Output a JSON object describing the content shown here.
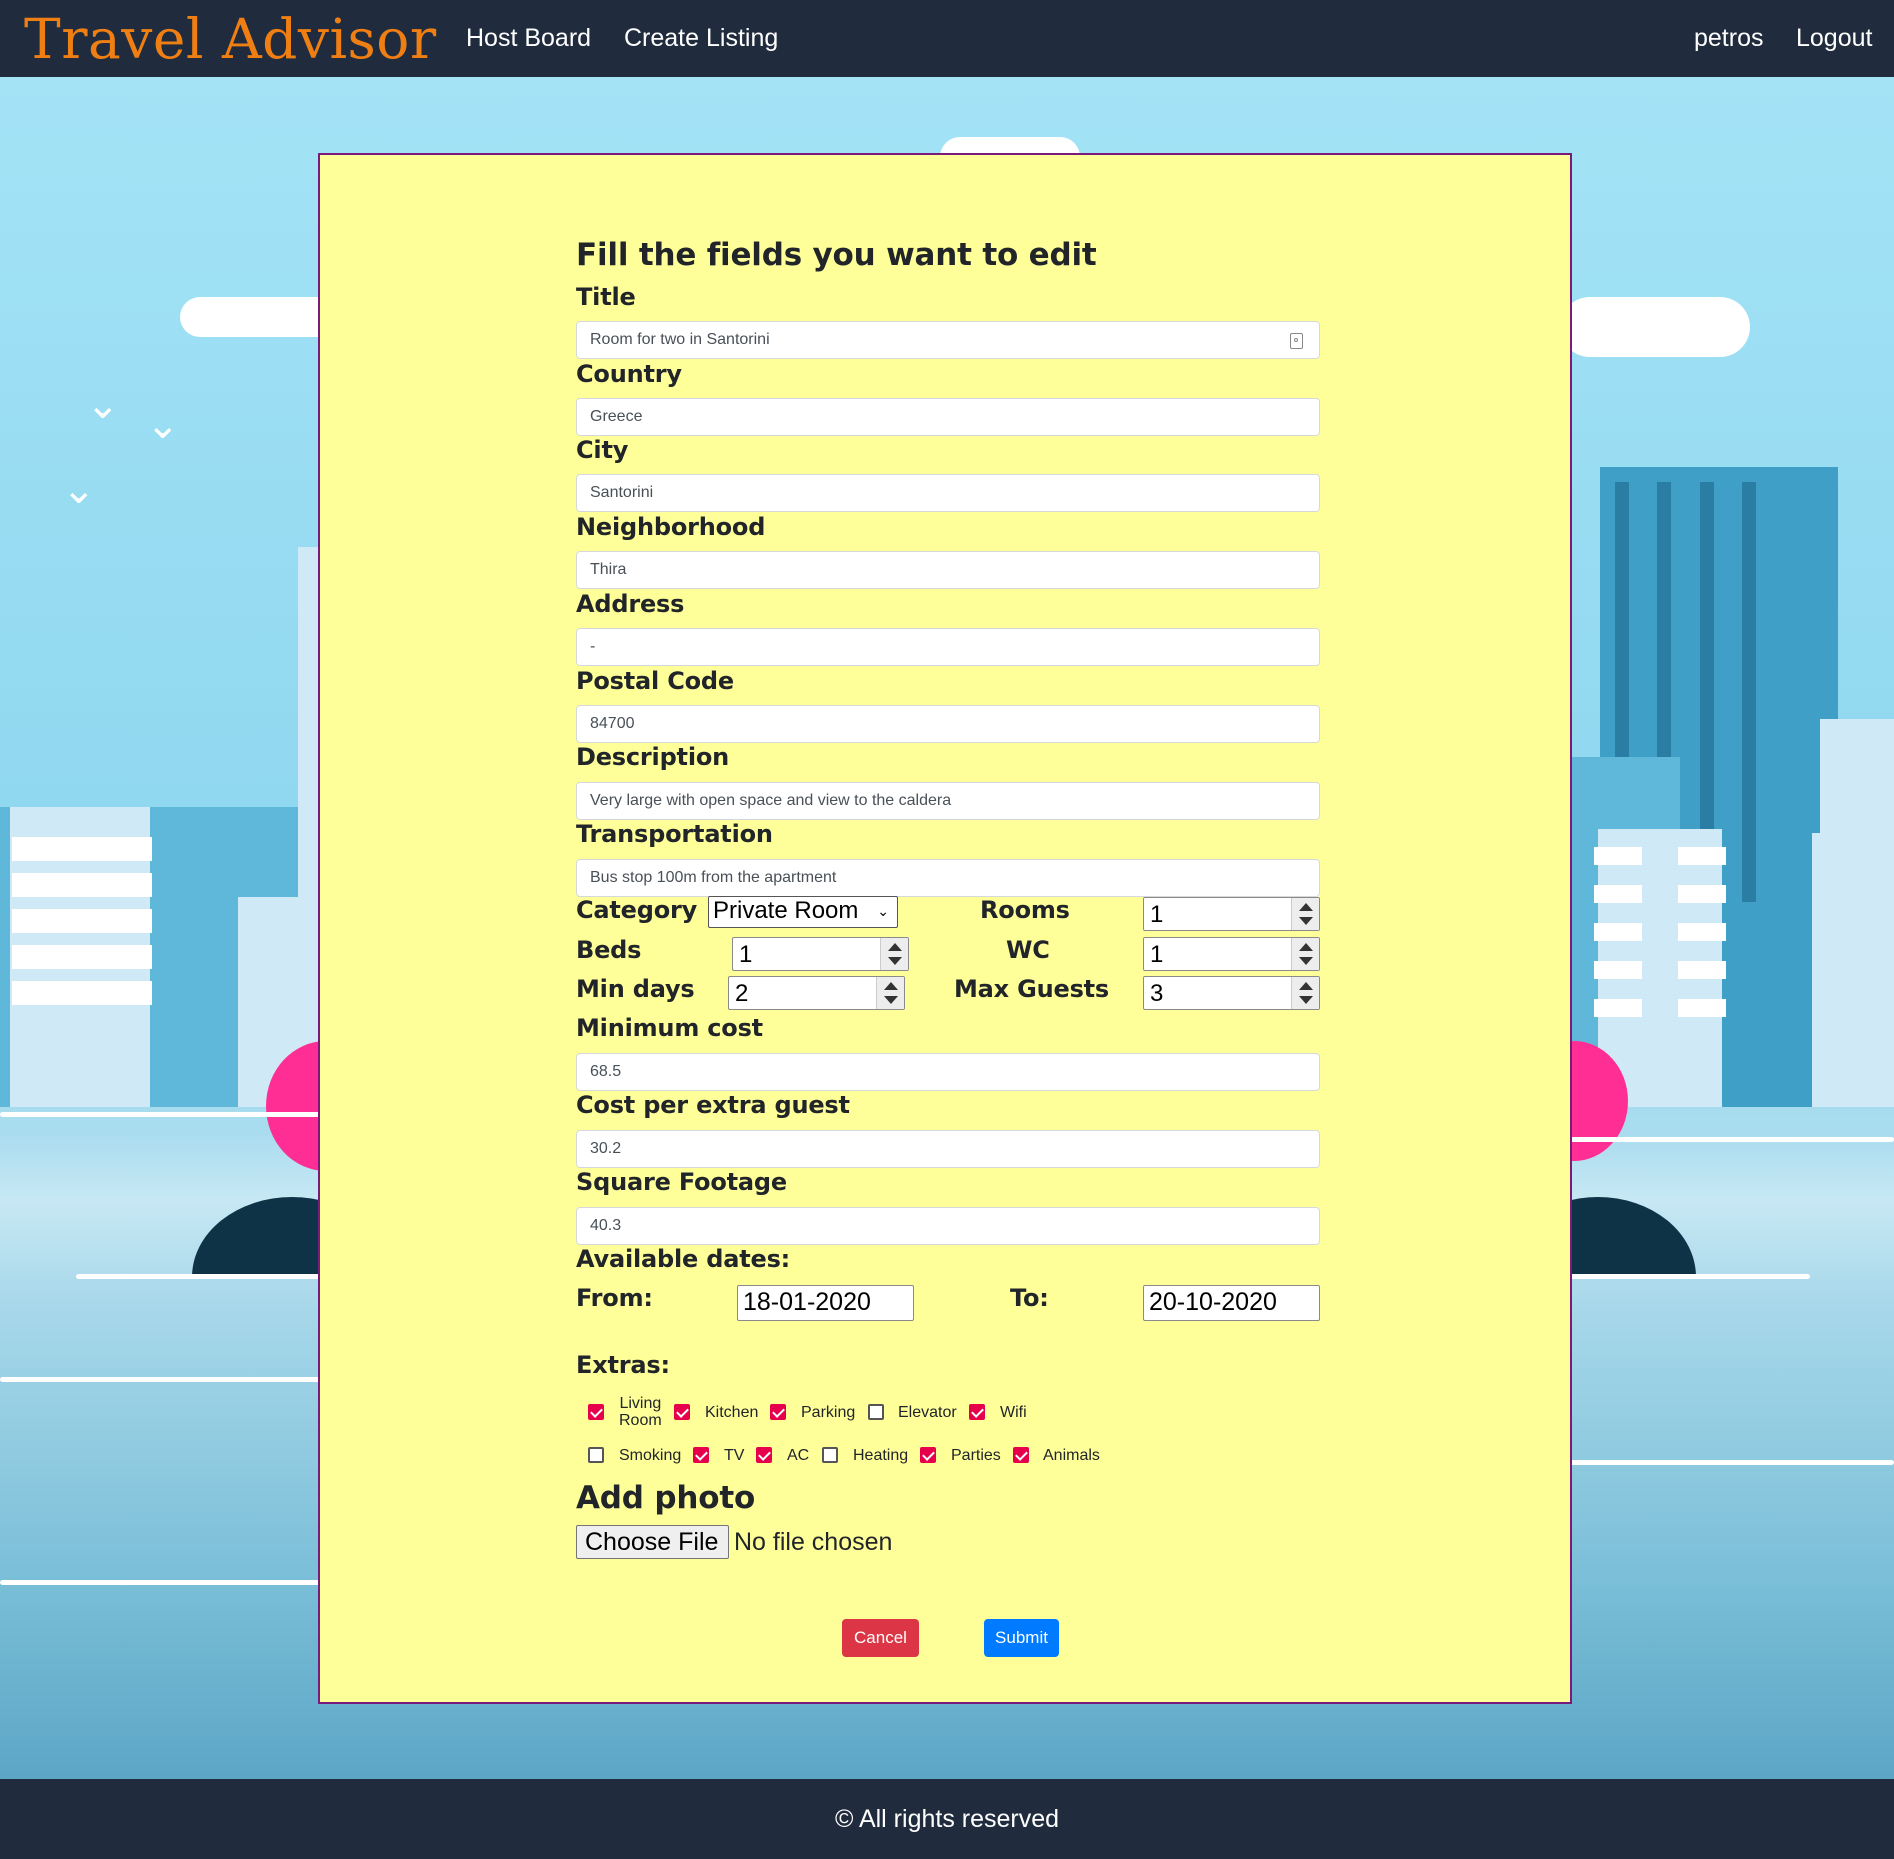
{
  "brand": {
    "name_first": "T",
    "name_rest": "ravel Advisor"
  },
  "nav": {
    "host_board": "Host Board",
    "create_listing": "Create Listing",
    "user": "petros",
    "logout": "Logout"
  },
  "form": {
    "heading": "Fill the fields you want to edit",
    "title_label": "Title",
    "title_value": "Room for two in Santorini",
    "country_label": "Country",
    "country_value": "Greece",
    "city_label": "City",
    "city_value": "Santorini",
    "neighborhood_label": "Neighborhood",
    "neighborhood_value": "Thira",
    "address_label": "Address",
    "address_value": "-",
    "postal_label": "Postal Code",
    "postal_value": "84700",
    "description_label": "Description",
    "description_value": "Very large with open space and view to the caldera",
    "transportation_label": "Transportation",
    "transportation_value": "Bus stop 100m from the apartment",
    "category_label": "Category",
    "category_value": "Private Room",
    "rooms_label": "Rooms",
    "rooms_value": "1",
    "beds_label": "Beds",
    "beds_value": "1",
    "wc_label": "WC",
    "wc_value": "1",
    "min_days_label": "Min days",
    "min_days_value": "2",
    "max_guests_label": "Max Guests",
    "max_guests_value": "3",
    "min_cost_label": "Minimum cost",
    "min_cost_value": "68.5",
    "extra_cost_label": "Cost per extra guest",
    "extra_cost_value": "30.2",
    "sqft_label": "Square Footage",
    "sqft_value": "40.3",
    "dates_label": "Available dates:",
    "from_label": "From:",
    "from_value": "18-01-2020",
    "to_label": "To:",
    "to_value": "20-10-2020",
    "extras_label": "Extras:",
    "extras_row1": [
      {
        "label_a": "Living",
        "label_b": "Room",
        "checked": true
      },
      {
        "label": "Kitchen",
        "checked": true
      },
      {
        "label": "Parking",
        "checked": true
      },
      {
        "label": "Elevator",
        "checked": false
      },
      {
        "label": "Wifi",
        "checked": true
      }
    ],
    "extras_row2": [
      {
        "label": "Smoking",
        "checked": false
      },
      {
        "label": "TV",
        "checked": true
      },
      {
        "label": "AC",
        "checked": true
      },
      {
        "label": "Heating",
        "checked": false
      },
      {
        "label": "Parties",
        "checked": true
      },
      {
        "label": "Animals",
        "checked": true
      }
    ],
    "photo_label": "Add photo",
    "file_button": "Choose File",
    "file_status": "No file chosen",
    "cancel": "Cancel",
    "submit": "Submit"
  },
  "footer": {
    "text": "© All rights reserved"
  },
  "colors": {
    "nav_bg": "#202c3e",
    "brand": "#f07f13",
    "panel_bg": "#ffff99",
    "panel_border": "#7a1a7a",
    "cancel": "#dc3545",
    "submit": "#007bff",
    "checkbox": "#e6004c"
  }
}
